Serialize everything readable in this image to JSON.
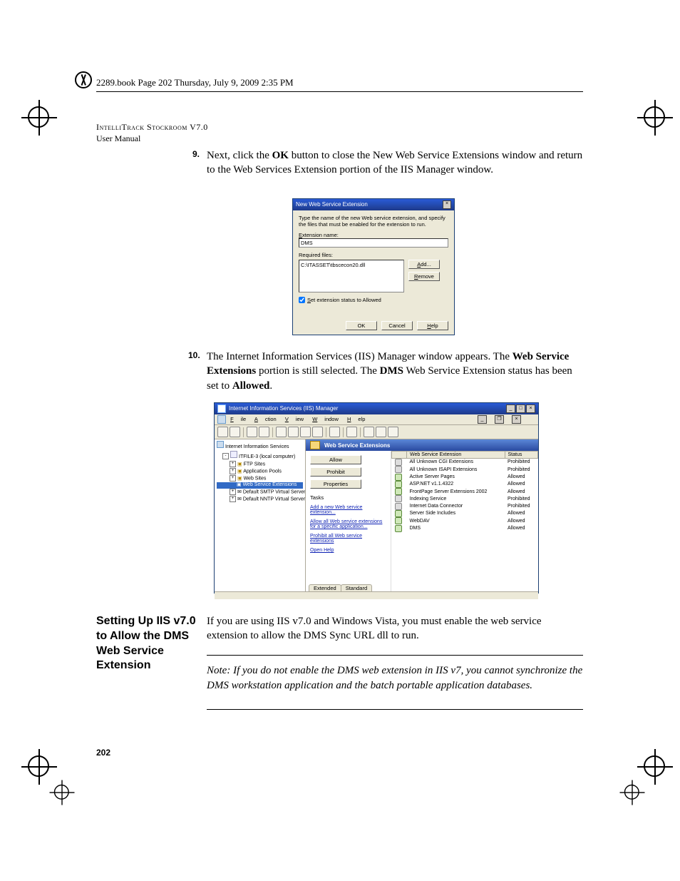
{
  "header": {
    "line": "2289.book  Page 202  Thursday, July 9, 2009  2:35 PM"
  },
  "running_head": {
    "smallcaps": "IntelliTrack Stockroom V7.0",
    "line2": "User Manual"
  },
  "step9": {
    "num": "9.",
    "pre": "Next, click the ",
    "bold": "OK",
    "post": " button to close the New Web Service Extensions window and return to the Web Services Extension portion of the IIS Manager window."
  },
  "dialog": {
    "title": "New Web Service Extension",
    "instr": "Type the name of the new Web service extension, and specify the files that must be enabled for the extension to run.",
    "ext_label": "Extension name:",
    "ext_value": "DMS",
    "req_label": "Required files:",
    "req_value": "C:\\ITASSET\\tbscecon20.dll",
    "add": "Add...",
    "remove": "Remove",
    "checkbox": "Set extension status to Allowed",
    "ok": "OK",
    "cancel": "Cancel",
    "help": "Help"
  },
  "step10": {
    "num": "10.",
    "t1": "The Internet Information Services (IIS) Manager window appears. The ",
    "b1": "Web Service Extensions",
    "t2": " portion is still selected. The ",
    "b2": "DMS",
    "t3": " Web Ser­vice Extension status has been set to ",
    "b3": "Allowed",
    "t4": "."
  },
  "iis": {
    "title": "Internet Information Services (IIS) Manager",
    "menu": {
      "file": "File",
      "action": "Action",
      "view": "View",
      "window": "Window",
      "help": "Help"
    },
    "tree": {
      "root": "Internet Information Services",
      "computer": "ITFILE-3 (local computer)",
      "ftp": "FTP Sites",
      "app": "Application Pools",
      "web": "Web Sites",
      "wse": "Web Service Extensions",
      "smtp": "Default SMTP Virtual Server",
      "nntp": "Default NNTP Virtual Server"
    },
    "pane_header": "Web Service Extensions",
    "buttons": {
      "allow": "Allow",
      "prohibit": "Prohibit",
      "properties": "Properties"
    },
    "tasks_label": "Tasks",
    "links": {
      "add": "Add a new Web service extension...",
      "allow": "Allow all Web service extensions for a specific application...",
      "prohibit": "Prohibit all Web service extensions",
      "help": "Open Help"
    },
    "columns": {
      "c1": "Web Service Extension",
      "c2": "Status"
    },
    "rows": [
      {
        "name": "All Unknown CGI Extensions",
        "status": "Prohibited",
        "icon": "q"
      },
      {
        "name": "All Unknown ISAPI Extensions",
        "status": "Prohibited",
        "icon": "q"
      },
      {
        "name": "Active Server Pages",
        "status": "Allowed",
        "icon": "g"
      },
      {
        "name": "ASP.NET v1.1.4322",
        "status": "Allowed",
        "icon": "g"
      },
      {
        "name": "FrontPage Server Extensions 2002",
        "status": "Allowed",
        "icon": "g"
      },
      {
        "name": "Indexing Service",
        "status": "Prohibited",
        "icon": "q"
      },
      {
        "name": "Internet Data Connector",
        "status": "Prohibited",
        "icon": "q"
      },
      {
        "name": "Server Side Includes",
        "status": "Allowed",
        "icon": "g"
      },
      {
        "name": "WebDAV",
        "status": "Allowed",
        "icon": "g"
      },
      {
        "name": "DMS",
        "status": "Allowed",
        "icon": "g"
      }
    ],
    "tabs": {
      "extended": "Extended",
      "standard": "Standard"
    }
  },
  "section": {
    "heading": "Setting Up IIS v7.0 to Allow the DMS Web Service Extension",
    "para": "If you are using IIS v7.0 and Windows Vista, you must enable the web ser­vice extension to allow the DMS Sync URL dll to run.",
    "note": "Note:   If you do not enable the DMS web extension in IIS v7, you cannot synchronize the DMS workstation application and the batch portable application databases."
  },
  "page_number": "202"
}
